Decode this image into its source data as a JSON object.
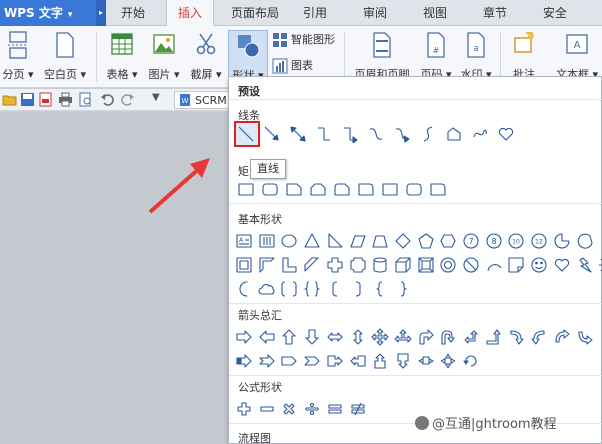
{
  "app": {
    "name": "WPS 文字"
  },
  "tabs": [
    {
      "label": "开始"
    },
    {
      "label": "插入",
      "active": true
    },
    {
      "label": "页面布局"
    },
    {
      "label": "引用"
    },
    {
      "label": "审阅"
    },
    {
      "label": "视图"
    },
    {
      "label": "章节"
    },
    {
      "label": "安全"
    }
  ],
  "ribbon": {
    "page_break": "分页",
    "blank_page": "空白页",
    "table": "表格",
    "picture": "图片",
    "screenshot": "截屏",
    "shapes": "形状",
    "smart_art": "智能图形",
    "chart": "图表",
    "header_footer": "页眉和页脚",
    "page_number": "页码",
    "watermark": "水印",
    "comment": "批注",
    "textbox": "文本框"
  },
  "quick_access": {
    "doc_tab": "SCRM"
  },
  "panel": {
    "preset_header": "预设",
    "sections": {
      "lines": "线条",
      "rect": "矩",
      "basic": "基本形状",
      "arrows": "箭头总汇",
      "formula": "公式形状",
      "flowchart": "流程图"
    },
    "tooltip": "直线"
  },
  "watermark_text": "@互通|ghtroom教程",
  "colors": {
    "accent": "#3a78d8",
    "active_tab": "#d23f3f",
    "selection": "#e02020",
    "shape_stroke": "#2c5a9a",
    "arrow": "#e53935"
  }
}
